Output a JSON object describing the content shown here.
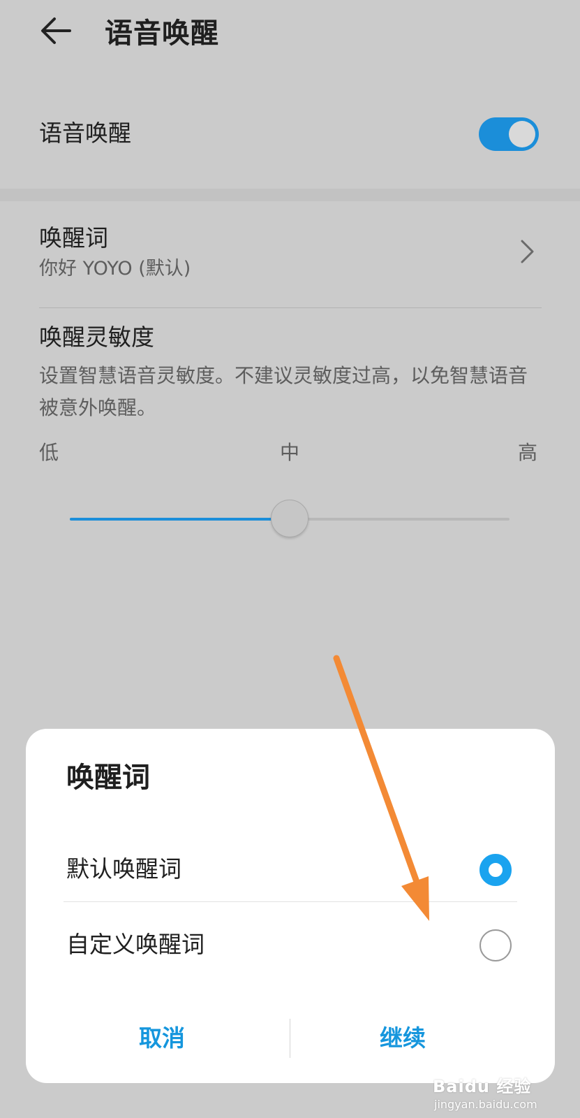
{
  "header": {
    "title": "语音唤醒",
    "back_icon": "arrow-left-icon"
  },
  "voice_wake": {
    "label": "语音唤醒",
    "enabled": true,
    "accent": "#1b8ed9"
  },
  "wake_word": {
    "title": "唤醒词",
    "value": "你好 YOYO (默认)",
    "chevron_icon": "chevron-right-icon"
  },
  "sensitivity": {
    "title": "唤醒灵敏度",
    "description": "设置智慧语音灵敏度。不建议灵敏度过高，以免智慧语音被意外唤醒。",
    "low_label": "低",
    "mid_label": "中",
    "high_label": "高",
    "level": 0.5
  },
  "dialog": {
    "title": "唤醒词",
    "options": [
      {
        "label": "默认唤醒词",
        "selected": true
      },
      {
        "label": "自定义唤醒词",
        "selected": false
      }
    ],
    "cancel_label": "取消",
    "continue_label": "继续",
    "button_color": "#1596dd"
  },
  "watermark": {
    "brand": "Baidu 经验",
    "url": "jingyan.baidu.com"
  }
}
